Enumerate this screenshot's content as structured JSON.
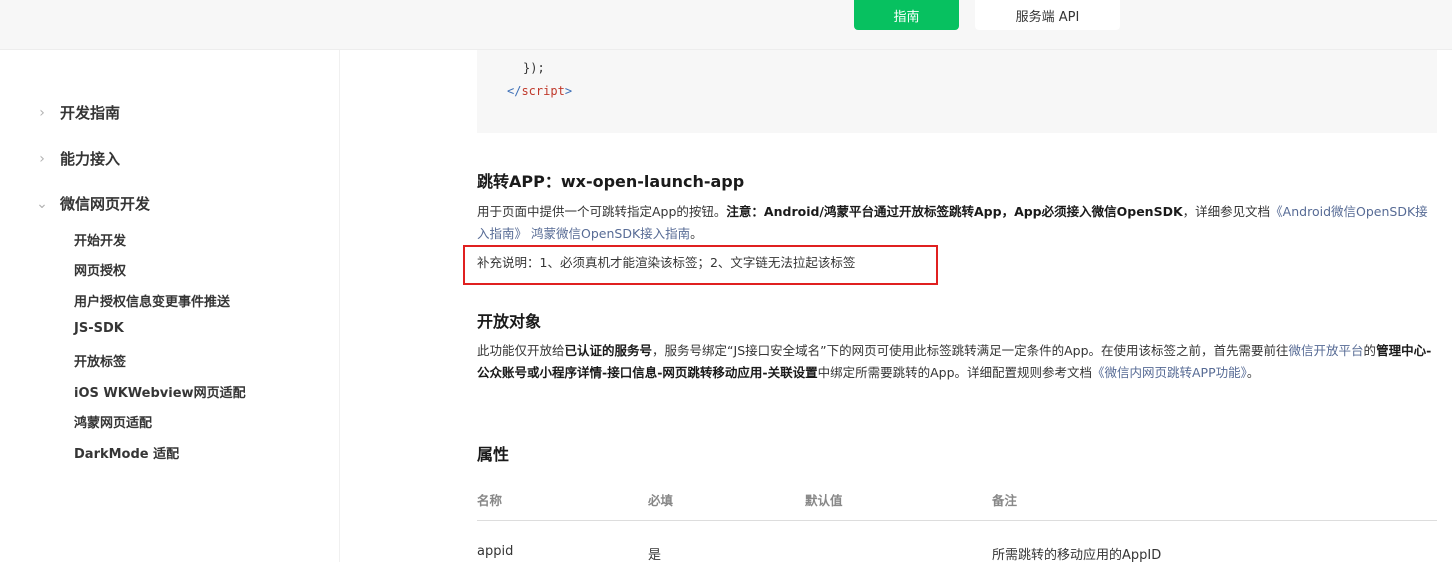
{
  "header": {
    "tabs": [
      {
        "label": "指南",
        "active": true
      },
      {
        "label": "服务端 API",
        "active": false
      }
    ],
    "accent_color": "#07c160"
  },
  "sidebar": {
    "chevron_collapsed": "›",
    "chevron_expanded": "⌄",
    "top_items": [
      {
        "label": "开发指南",
        "expanded": false
      },
      {
        "label": "能力接入",
        "expanded": false
      },
      {
        "label": "微信网页开发",
        "expanded": true
      }
    ],
    "sub_items": [
      {
        "label": "开始开发"
      },
      {
        "label": "网页授权"
      },
      {
        "label": "用户授权信息变更事件推送"
      },
      {
        "label": "JS-SDK"
      },
      {
        "label": "开放标签"
      },
      {
        "label": "iOS WKWebview网页适配"
      },
      {
        "label": "鸿蒙网页适配"
      },
      {
        "label": "DarkMode 适配"
      }
    ]
  },
  "code": {
    "line1": "});",
    "line2_open": "</",
    "line2_tag": "script",
    "line2_close": ">"
  },
  "section1": {
    "title": "跳转APP：wx-open-launch-app",
    "desc_a": "用于页面中提供一个可跳转指定App的按钮。",
    "desc_b": "注意：Android/鸿蒙平台通过开放标签跳转App，App必须接入微信OpenSDK",
    "desc_c": "，详细参见文档",
    "link1": "《Android微信OpenSDK接入指南》",
    "link2": "鸿蒙微信OpenSDK接入指南",
    "desc_end": "。",
    "note": "补充说明：1、必须真机才能渲染该标签；2、文字链无法拉起该标签"
  },
  "section2": {
    "title": "开放对象",
    "p_a": "此功能仅开放给",
    "p_b": "已认证的服务号",
    "p_c": "，服务号绑定“JS接口安全域名”下的网页可使用此标签跳转满足一定条件的App。在使用该标签之前，首先需要前往",
    "link1": "微信开放平台",
    "p_d": "的",
    "p_e": "管理中心-公众账号或小程序详情-接口信息-网页跳转移动应用-关联设置",
    "p_f": "中绑定所需要跳转的App。详细配置规则参考文档",
    "link2": "《微信内网页跳转APP功能》",
    "p_end": "。"
  },
  "section3": {
    "title": "属性",
    "columns": [
      "名称",
      "必填",
      "默认值",
      "备注"
    ],
    "rows": [
      {
        "name": "appid",
        "required": "是",
        "default": "",
        "note": "所需跳转的移动应用的AppID"
      }
    ]
  }
}
